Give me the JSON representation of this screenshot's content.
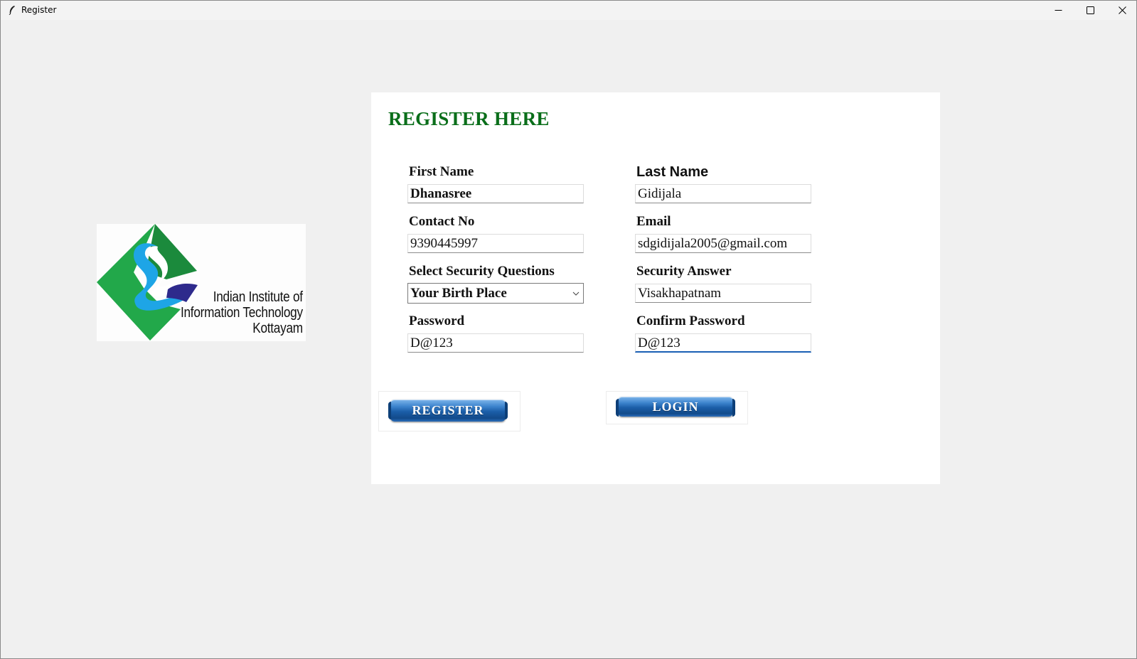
{
  "window": {
    "title": "Register",
    "icon": "feather-icon",
    "controls": [
      "minimize-icon",
      "maximize-icon",
      "close-icon"
    ]
  },
  "logo": {
    "line1": "Indian Institute of",
    "line2": "Information Technology",
    "line3": "Kottayam",
    "colors": {
      "green": "#22a84a",
      "dark_green": "#1b8a3c",
      "blue": "#1ea5e6",
      "navy": "#2e2a8c"
    }
  },
  "form": {
    "heading": "REGISTER HERE",
    "heading_color": "#0a6e1a",
    "first_name": {
      "label": "First Name",
      "value": "Dhanasree"
    },
    "last_name": {
      "label": "Last Name",
      "value": "Gidijala"
    },
    "contact": {
      "label": "Contact No",
      "value": "9390445997"
    },
    "email": {
      "label": "Email",
      "value": "sdgidijala2005@gmail.com"
    },
    "security_question": {
      "label": "Select Security Questions",
      "value": "Your Birth Place"
    },
    "security_answer": {
      "label": "Security Answer",
      "value": "Visakhapatnam"
    },
    "password": {
      "label": "Password",
      "value": "D@123"
    },
    "confirm_password": {
      "label": "Confirm Password",
      "value": "D@123"
    }
  },
  "buttons": {
    "register": "REGISTER",
    "login": "LOGIN",
    "color": "#1b5ea8"
  }
}
